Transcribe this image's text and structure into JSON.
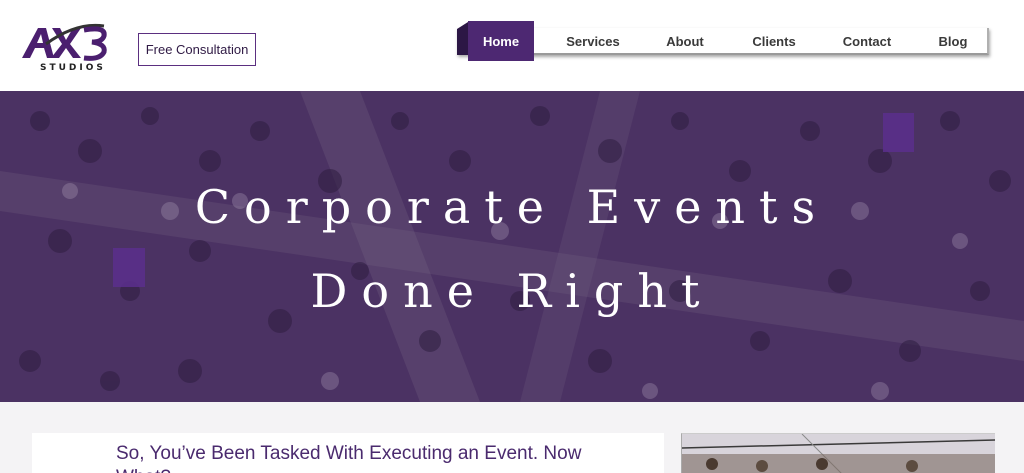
{
  "header": {
    "logo_text": "AX3",
    "logo_sub": "STUDIOS",
    "consult_label": "Free Consultation"
  },
  "nav": {
    "items": [
      {
        "label": "Home",
        "active": true
      },
      {
        "label": "Services",
        "active": false
      },
      {
        "label": "About",
        "active": false
      },
      {
        "label": "Clients",
        "active": false
      },
      {
        "label": "Contact",
        "active": false
      },
      {
        "label": "Blog",
        "active": false
      }
    ]
  },
  "hero": {
    "line1": "Corporate Events",
    "line2": "Done Right"
  },
  "main": {
    "card_title": "So, You’ve Been Tasked With Executing an Event. Now What?"
  },
  "colors": {
    "brand_purple": "#4d2872",
    "hero_overlay": "#4e3468",
    "text_purple": "#4a2a6e"
  }
}
